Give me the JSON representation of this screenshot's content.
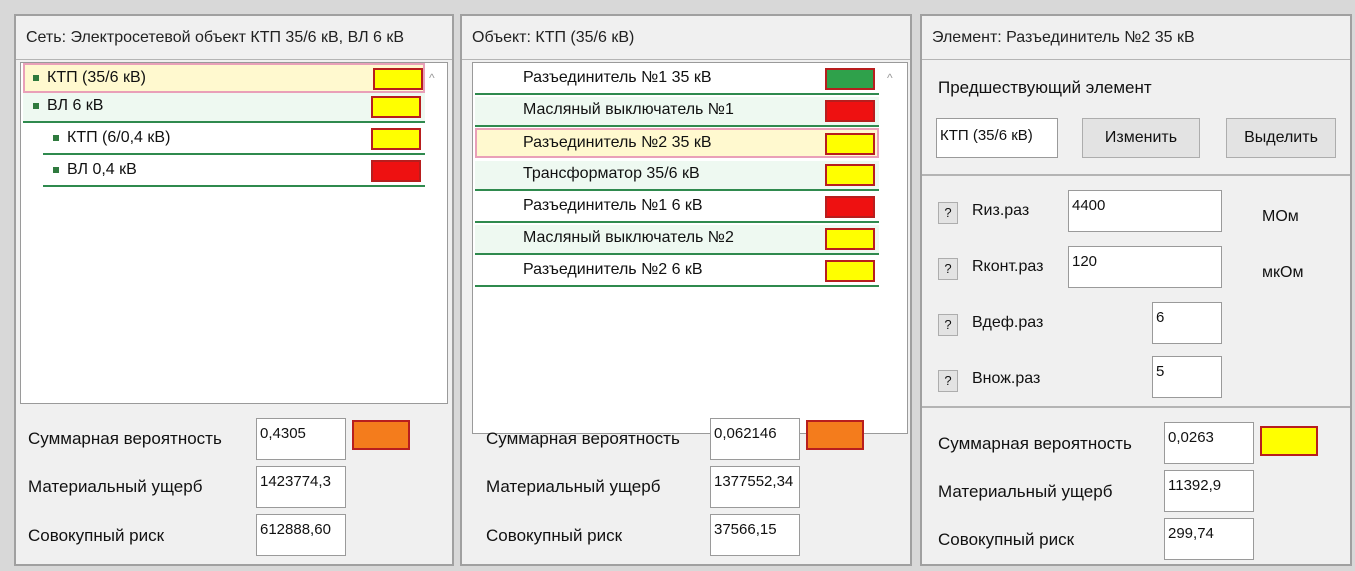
{
  "colors": {
    "green": "#2fa14b",
    "yellow": "#ffff00",
    "red": "#ee1111",
    "orange": "#f47c1c",
    "row_border": "#2f8a4e",
    "swatch_border": "#b81e1e"
  },
  "network_panel": {
    "title": "Сеть: Электросетевой объект КТП 35/6 кВ, ВЛ 6 кВ",
    "scroll_icon": "chevron-up-icon",
    "items": [
      {
        "label": "КТП (35/6 кВ)",
        "status": "yellow",
        "selected": true
      },
      {
        "label": "ВЛ 6 кВ",
        "status": "yellow",
        "selected": false
      },
      {
        "label": "КТП (6/0,4 кВ)",
        "status": "yellow",
        "selected": false
      },
      {
        "label": "ВЛ 0,4 кВ",
        "status": "red",
        "selected": false
      }
    ],
    "summary": {
      "prob_label": "Суммарная вероятность",
      "prob_value": "0,4305",
      "prob_color": "orange",
      "damage_label": "Материальный ущерб",
      "damage_value": "1423774,3",
      "risk_label": "Совокупный риск",
      "risk_value": "612888,60"
    }
  },
  "object_panel": {
    "title": "Объект: КТП (35/6 кВ)",
    "scroll_icon": "chevron-up-icon",
    "items": [
      {
        "label": "Разъединитель №1 35 кВ",
        "status": "green",
        "selected": false
      },
      {
        "label": "Масляный выключатель №1",
        "status": "red",
        "selected": false
      },
      {
        "label": "Разъединитель №2 35 кВ",
        "status": "yellow",
        "selected": true
      },
      {
        "label": "Трансформатор 35/6 кВ",
        "status": "yellow",
        "selected": false
      },
      {
        "label": "Разъединитель №1 6 кВ",
        "status": "red",
        "selected": false
      },
      {
        "label": "Масляный выключатель №2",
        "status": "yellow",
        "selected": false
      },
      {
        "label": "Разъединитель №2 6 кВ",
        "status": "yellow",
        "selected": false
      }
    ],
    "summary": {
      "prob_label": "Суммарная вероятность",
      "prob_value": "0,062146",
      "prob_color": "orange",
      "damage_label": "Материальный ущерб",
      "damage_value": "1377552,34",
      "risk_label": "Совокупный риск",
      "risk_value": "37566,15"
    }
  },
  "element_panel": {
    "title": "Элемент: Разъединитель №2 35 кВ",
    "predecessor_label": "Предшествующий элемент",
    "predecessor_value": "КТП (35/6 кВ)",
    "change_button": "Изменить",
    "select_button": "Выделить",
    "help_label": "?",
    "params": [
      {
        "name": "Rиз.раз",
        "value": "4400",
        "unit": "МОм"
      },
      {
        "name": "Rконт.раз",
        "value": "120",
        "unit": "мкОм"
      },
      {
        "name": "Вдеф.раз",
        "value": "6",
        "unit": ""
      },
      {
        "name": "Внож.раз",
        "value": "5",
        "unit": ""
      }
    ],
    "summary": {
      "prob_label": "Суммарная вероятность",
      "prob_value": "0,0263",
      "prob_color": "yellow",
      "damage_label": "Материальный ущерб",
      "damage_value": "11392,9",
      "risk_label": "Совокупный риск",
      "risk_value": "299,74"
    }
  }
}
